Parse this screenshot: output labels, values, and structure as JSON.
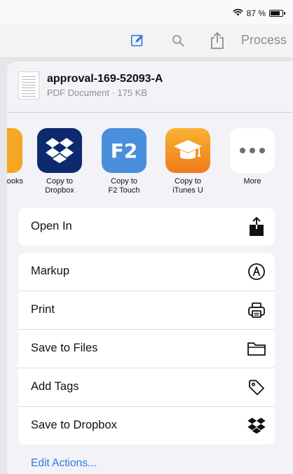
{
  "status": {
    "battery": "87 %",
    "battery_level": 0.87,
    "icons": [
      "wifi-icon",
      "battery-icon"
    ]
  },
  "nav": {
    "process_label": "Process",
    "icons": [
      "edit-icon",
      "search-icon",
      "share-icon"
    ]
  },
  "document": {
    "name": "approval-169-52093-A",
    "meta": "PDF Document · 175 KB"
  },
  "apps": [
    {
      "label": "ooks",
      "icon": "books-icon",
      "color": "#f5a623"
    },
    {
      "label": "Copy to\nDropbox",
      "icon": "dropbox-icon",
      "color": "#0d2a6e"
    },
    {
      "label": "Copy to\nF2 Touch",
      "icon": "f2-touch-icon",
      "icon_text": "F2",
      "color": "#4a8fdc"
    },
    {
      "label": "Copy to\niTunes U",
      "icon": "itunes-u-icon",
      "color": "#f39c27"
    },
    {
      "label": "More",
      "icon": "more-icon",
      "color": "#ffffff"
    }
  ],
  "actions_group1": [
    {
      "label": "Open In",
      "icon": "open-in-icon"
    }
  ],
  "actions_group2": [
    {
      "label": "Markup",
      "icon": "markup-icon"
    },
    {
      "label": "Print",
      "icon": "print-icon"
    },
    {
      "label": "Save to Files",
      "icon": "folder-icon"
    },
    {
      "label": "Add Tags",
      "icon": "tag-icon"
    },
    {
      "label": "Save to Dropbox",
      "icon": "dropbox-icon"
    }
  ],
  "edit_actions_label": "Edit Actions...",
  "colors": {
    "accent": "#2f7ae5",
    "secondary_text": "#8e8e93",
    "sheet_bg": "#f2f2f7"
  }
}
